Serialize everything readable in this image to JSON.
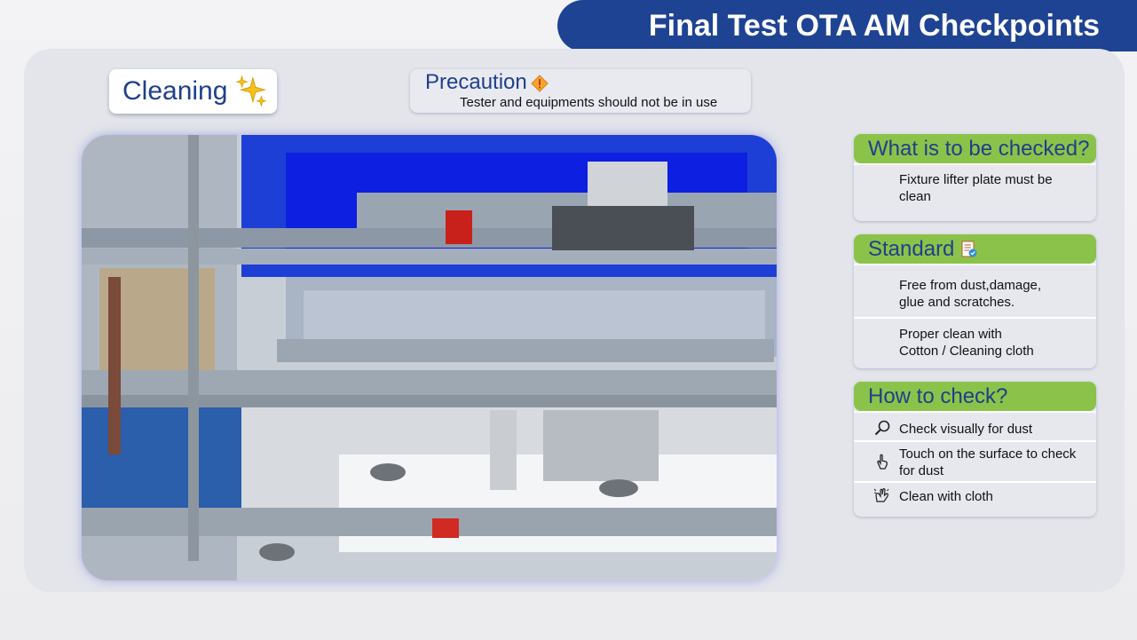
{
  "header": {
    "title": "Final Test OTA AM Checkpoints"
  },
  "cleaning_tag": {
    "label": "Cleaning",
    "icon": "sparkles-icon"
  },
  "precaution": {
    "title": "Precaution",
    "icon": "warning-icon",
    "text": "Tester and equipments should not be in use"
  },
  "machine_image": {
    "icon": "fixture-machine-image"
  },
  "what_checked": {
    "title": "What is to be checked?",
    "lines": [
      "Fixture lifter plate must be",
      "clean"
    ]
  },
  "standard": {
    "title": "Standard",
    "icon": "checklist-icon",
    "items": [
      {
        "lines": [
          "Free from dust,damage,",
          "glue and scratches."
        ]
      },
      {
        "lines": [
          "Proper clean with",
          "Cotton / Cleaning cloth"
        ]
      }
    ]
  },
  "how_to_check": {
    "title": "How to check?",
    "items": [
      {
        "icon": "magnifier-icon",
        "lines": [
          "Check visually for dust"
        ]
      },
      {
        "icon": "finger-touch-icon",
        "lines": [
          "Touch on the surface to check",
          "for dust"
        ]
      },
      {
        "icon": "cleaning-hand-icon",
        "lines": [
          "Clean with cloth"
        ]
      }
    ]
  },
  "colors": {
    "banner": "#1f4393",
    "header_green": "#8bc34a",
    "title_blue": "#1f3f8c",
    "panel": "#e3e5eb"
  }
}
